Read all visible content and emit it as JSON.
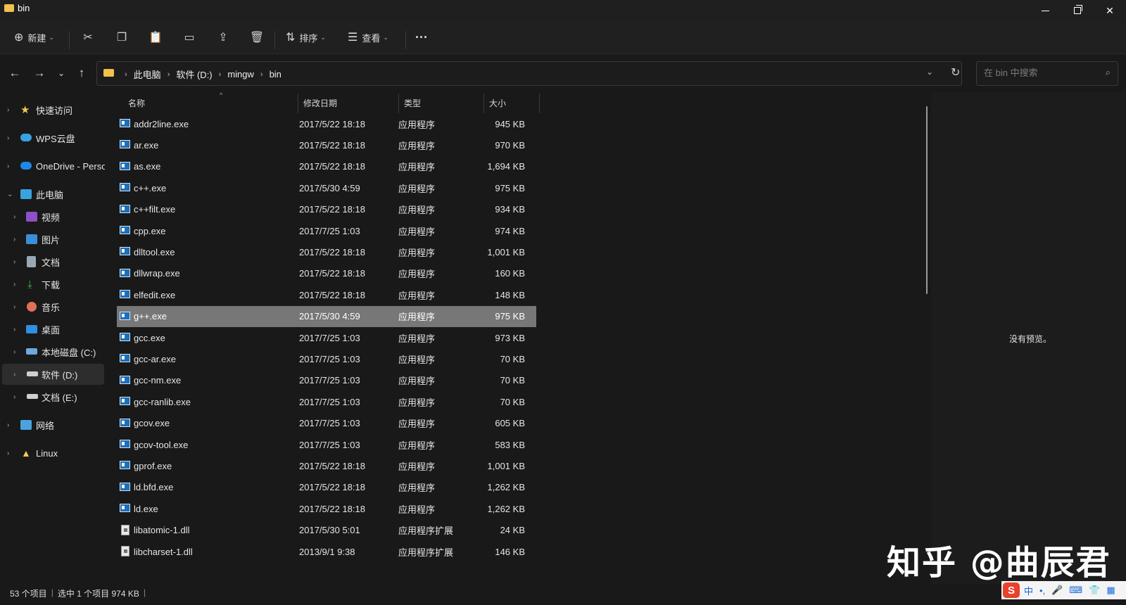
{
  "window": {
    "title": "bin"
  },
  "toolbar": {
    "new_label": "新建",
    "sort_label": "排序",
    "view_label": "查看",
    "more_label": "···"
  },
  "address": {
    "crumbs": [
      "此电脑",
      "软件 (D:)",
      "mingw",
      "bin"
    ]
  },
  "search": {
    "placeholder": "在 bin 中搜索"
  },
  "sidebar": {
    "items": [
      {
        "label": "快速访问",
        "icon": "star-icon"
      },
      {
        "label": "WPS云盘",
        "icon": "cloud-icon"
      },
      {
        "label": "OneDrive - Perso",
        "icon": "onedrive-icon"
      },
      {
        "label": "此电脑",
        "icon": "computer-icon"
      },
      {
        "label": "视频",
        "icon": "video-icon"
      },
      {
        "label": "图片",
        "icon": "picture-icon"
      },
      {
        "label": "文档",
        "icon": "document-icon"
      },
      {
        "label": "下载",
        "icon": "download-icon"
      },
      {
        "label": "音乐",
        "icon": "music-icon"
      },
      {
        "label": "桌面",
        "icon": "desktop-icon"
      },
      {
        "label": "本地磁盘 (C:)",
        "icon": "drive-icon"
      },
      {
        "label": "软件 (D:)",
        "icon": "drive-icon"
      },
      {
        "label": "文档 (E:)",
        "icon": "drive-icon"
      },
      {
        "label": "网络",
        "icon": "network-icon"
      },
      {
        "label": "Linux",
        "icon": "linux-icon"
      }
    ]
  },
  "columns": {
    "name": "名称",
    "date": "修改日期",
    "type": "类型",
    "size": "大小"
  },
  "files": [
    {
      "name": "addr2line.exe",
      "date": "2017/5/22 18:18",
      "type": "应用程序",
      "size": "945 KB"
    },
    {
      "name": "ar.exe",
      "date": "2017/5/22 18:18",
      "type": "应用程序",
      "size": "970 KB"
    },
    {
      "name": "as.exe",
      "date": "2017/5/22 18:18",
      "type": "应用程序",
      "size": "1,694 KB"
    },
    {
      "name": "c++.exe",
      "date": "2017/5/30 4:59",
      "type": "应用程序",
      "size": "975 KB"
    },
    {
      "name": "c++filt.exe",
      "date": "2017/5/22 18:18",
      "type": "应用程序",
      "size": "934 KB"
    },
    {
      "name": "cpp.exe",
      "date": "2017/7/25 1:03",
      "type": "应用程序",
      "size": "974 KB"
    },
    {
      "name": "dlltool.exe",
      "date": "2017/5/22 18:18",
      "type": "应用程序",
      "size": "1,001 KB"
    },
    {
      "name": "dllwrap.exe",
      "date": "2017/5/22 18:18",
      "type": "应用程序",
      "size": "160 KB"
    },
    {
      "name": "elfedit.exe",
      "date": "2017/5/22 18:18",
      "type": "应用程序",
      "size": "148 KB"
    },
    {
      "name": "g++.exe",
      "date": "2017/5/30 4:59",
      "type": "应用程序",
      "size": "975 KB"
    },
    {
      "name": "gcc.exe",
      "date": "2017/7/25 1:03",
      "type": "应用程序",
      "size": "973 KB"
    },
    {
      "name": "gcc-ar.exe",
      "date": "2017/7/25 1:03",
      "type": "应用程序",
      "size": "70 KB"
    },
    {
      "name": "gcc-nm.exe",
      "date": "2017/7/25 1:03",
      "type": "应用程序",
      "size": "70 KB"
    },
    {
      "name": "gcc-ranlib.exe",
      "date": "2017/7/25 1:03",
      "type": "应用程序",
      "size": "70 KB"
    },
    {
      "name": "gcov.exe",
      "date": "2017/7/25 1:03",
      "type": "应用程序",
      "size": "605 KB"
    },
    {
      "name": "gcov-tool.exe",
      "date": "2017/7/25 1:03",
      "type": "应用程序",
      "size": "583 KB"
    },
    {
      "name": "gprof.exe",
      "date": "2017/5/22 18:18",
      "type": "应用程序",
      "size": "1,001 KB"
    },
    {
      "name": "ld.bfd.exe",
      "date": "2017/5/22 18:18",
      "type": "应用程序",
      "size": "1,262 KB"
    },
    {
      "name": "ld.exe",
      "date": "2017/5/22 18:18",
      "type": "应用程序",
      "size": "1,262 KB"
    },
    {
      "name": "libatomic-1.dll",
      "date": "2017/5/30 5:01",
      "type": "应用程序扩展",
      "size": "24 KB"
    },
    {
      "name": "libcharset-1.dll",
      "date": "2013/9/1 9:38",
      "type": "应用程序扩展",
      "size": "146 KB"
    }
  ],
  "selected_file": "g++.exe",
  "preview": {
    "text": "没有预览。"
  },
  "status": {
    "count": "53 个项目",
    "selection": "选中 1 个项目 974 KB"
  },
  "watermark": {
    "text": "知乎 @曲辰君"
  },
  "ime": {
    "mode": "中"
  }
}
